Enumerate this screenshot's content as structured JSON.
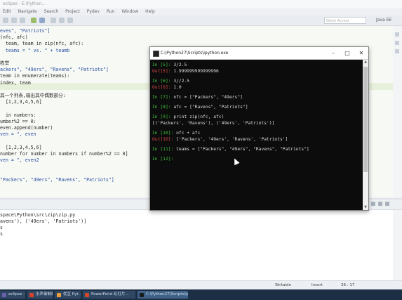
{
  "ide": {
    "title": "eclipse - E:\\Python...",
    "menu": [
      "Edit",
      "Navigate",
      "Search",
      "Project",
      "Pydev",
      "Run",
      "Window",
      "Help"
    ],
    "quick_access": "Quick Access",
    "perspective": "Java EE",
    "editor_lines": [
      "eves\", \"Patriots\"]",
      "(nfc, afc)",
      "  team, team in zip(nfc, afc):",
      "  teams = \" vs. \" + teamb",
      "",
      "枚举",
      "ackers\", \"49ers\", \"Ravens\", \"Patriots\"]",
      "team in enumerate(teams):",
      "index, team",
      "",
      "其一个列表,输出其中偶数部分:",
      "  [1,2,3,4,5,6]",
      "",
      "  in numbers:",
      "umber%2 == 0:",
      "even.append(number)",
      "ven = \", even",
      "",
      "  [1,2,3,4,5,6]",
      "number for number in numbers if number%2 == 0]",
      "ven = \", even2",
      "",
      "",
      "\"Packers\", \"49ers\", \"Ravens\", \"Patriots\"]"
    ],
    "console_lines": [
      "space\\Python\\src\\zip\\zip.py",
      "avens'), ('49ers', 'Patriots')]",
      "s",
      "s"
    ],
    "status": {
      "writable": "Writable",
      "insert": "Insert",
      "position": "36 : 17"
    }
  },
  "cmd": {
    "title": "C:\\Python27\\Scripts\\ipython.exe",
    "lines": [
      {
        "kind": "in",
        "prompt": "In [5]:",
        "text": " 3/2.5"
      },
      {
        "kind": "out",
        "prompt": "Out[5]:",
        "text": " 1.999999999999996"
      },
      {
        "kind": "blank",
        "prompt": "",
        "text": ""
      },
      {
        "kind": "in",
        "prompt": "In [6]:",
        "text": " 3//2.5"
      },
      {
        "kind": "out",
        "prompt": "Out[6]:",
        "text": " 1.0"
      },
      {
        "kind": "blank",
        "prompt": "",
        "text": ""
      },
      {
        "kind": "in",
        "prompt": "In [7]:",
        "text": " nfc = [\"Packers\", \"49ers\"]"
      },
      {
        "kind": "blank",
        "prompt": "",
        "text": ""
      },
      {
        "kind": "in",
        "prompt": "In [8]:",
        "text": " afc = [\"Ravens\", \"Patriots\"]"
      },
      {
        "kind": "blank",
        "prompt": "",
        "text": ""
      },
      {
        "kind": "in",
        "prompt": "In [9]:",
        "text": " print zip(nfc, afc)"
      },
      {
        "kind": "plain",
        "prompt": "",
        "text": "[('Packers', 'Ravens'), ('49ers', 'Patriots')]"
      },
      {
        "kind": "blank",
        "prompt": "",
        "text": ""
      },
      {
        "kind": "in",
        "prompt": "In [10]:",
        "text": " nfc + afc"
      },
      {
        "kind": "out",
        "prompt": "Out[10]:",
        "text": " ['Packers', '49ers', 'Ravens', 'Patriots']"
      },
      {
        "kind": "blank",
        "prompt": "",
        "text": ""
      },
      {
        "kind": "in",
        "prompt": "In [11]:",
        "text": " teams = [\"Packers\", \"49ers\", \"Ravens\", \"Patriots\"]"
      },
      {
        "kind": "blank",
        "prompt": "",
        "text": ""
      },
      {
        "kind": "in",
        "prompt": "In [12]:",
        "text": ""
      }
    ]
  },
  "taskbar": {
    "items": [
      {
        "label": "eclipse - E:\\...",
        "color": "#6b5fb0",
        "active": false
      },
      {
        "label": "水声录制软件",
        "color": "#d8402a",
        "active": false
      },
      {
        "label": "优豆 Pyt...",
        "color": "#e8a13a",
        "active": false
      },
      {
        "label": "PowerPoint 幻灯片...",
        "color": "#d24726",
        "active": false
      },
      {
        "label": "C:\\Python27\\Scripts\\ipy...",
        "color": "#1b1b1b",
        "active": true
      }
    ]
  }
}
